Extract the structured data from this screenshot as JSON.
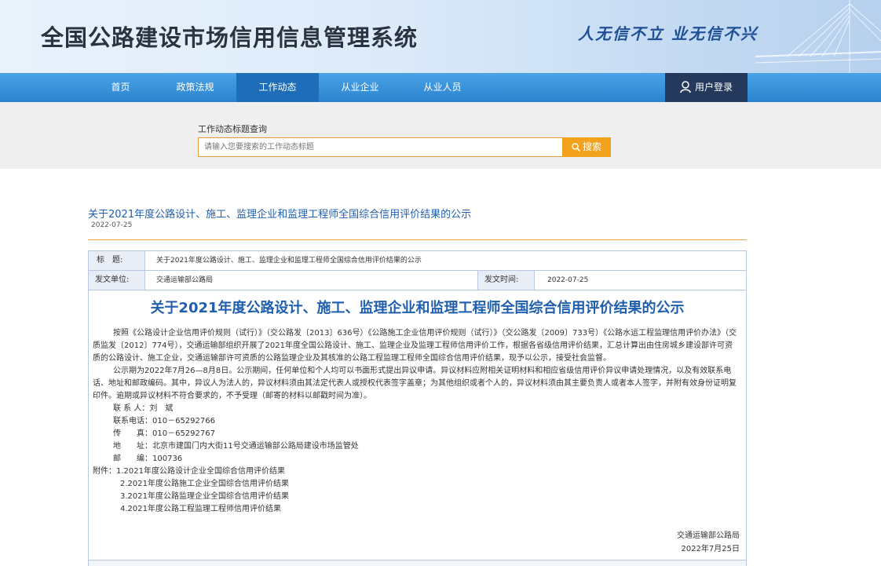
{
  "header": {
    "title": "全国公路建设市场信用信息管理系统",
    "slogan": "人无信不立 业无信不兴"
  },
  "nav": {
    "items": [
      {
        "label": "首页"
      },
      {
        "label": "政策法规"
      },
      {
        "label": "工作动态"
      },
      {
        "label": "从业企业"
      },
      {
        "label": "从业人员"
      }
    ],
    "active_index": 2,
    "login_label": "用户登录"
  },
  "search": {
    "label": "工作动态标题查询",
    "placeholder": "请输入您要搜索的工作动态标题",
    "button_label": "搜索"
  },
  "article": {
    "title": "关于2021年度公路设计、施工、监理企业和监理工程师全国综合信用评价结果的公示",
    "date": "2022-07-25",
    "info": {
      "title_label": "标　题:",
      "title_value": "关于2021年度公路设计、施工、监理企业和监理工程师全国综合信用评价结果的公示",
      "issuer_label": "发文单位:",
      "issuer_value": "交通运输部公路局",
      "date_label": "发文时间:",
      "date_value": "2022-07-25"
    },
    "heading": "关于2021年度公路设计、施工、监理企业和监理工程师全国综合信用评价结果的公示",
    "paragraphs": [
      "按照《公路设计企业信用评价规则（试行）》（交公路发〔2013〕636号）《公路施工企业信用评价规则（试行）》（交公路发〔2009〕733号）《公路水运工程监理信用评价办法》（交质监发〔2012〕774号），交通运输部组织开展了2021年度全国公路设计、施工、监理企业及监理工程师信用评价工作，根据各省级信用评价结果，汇总计算出由住房城乡建设部许可资质的公路设计、施工企业，交通运输部许可资质的公路监理企业及其核准的公路工程监理工程师全国综合信用评价结果，现予以公示，接受社会监督。",
      "公示期为2022年7月26—8月8日。公示期间，任何单位和个人均可以书面形式提出异议申请。异议材料应附相关证明材料和相应省级信用评价异议申请处理情况，以及有效联系电话、地址和邮政编码。其中，异议人为法人的，异议材料须由其法定代表人或授权代表签字盖章；为其他组织或者个人的，异议材料须由其主要负责人或者本人签字，并附有效身份证明复印件。逾期或异议材料不符合要求的，不予受理（邮寄的材料以邮戳时间为准）。"
    ],
    "contacts": [
      "联 系 人：刘　斌",
      "联系电话：010－65292766",
      "传　　真：010－65292767",
      "地　　址：北京市建国门内大街11号交通运输部公路局建设市场监管处",
      "邮　　编：100736"
    ],
    "attachments": [
      "附件：1.2021年度公路设计企业全国综合信用评价结果",
      "2.2021年度公路施工企业全国综合信用评价结果",
      "3.2021年度公路监理企业全国综合信用评价结果",
      "4.2021年度公路工程监理工程师信用评价结果"
    ],
    "signature": {
      "org": "交通运输部公路局",
      "date": "2022年7月25日"
    }
  },
  "colors": {
    "nav_bg": "#3793dc",
    "nav_active": "#1d6db8",
    "login_bg": "#25395d",
    "accent_orange": "#f2a21d",
    "link_blue": "#1f5fae"
  }
}
